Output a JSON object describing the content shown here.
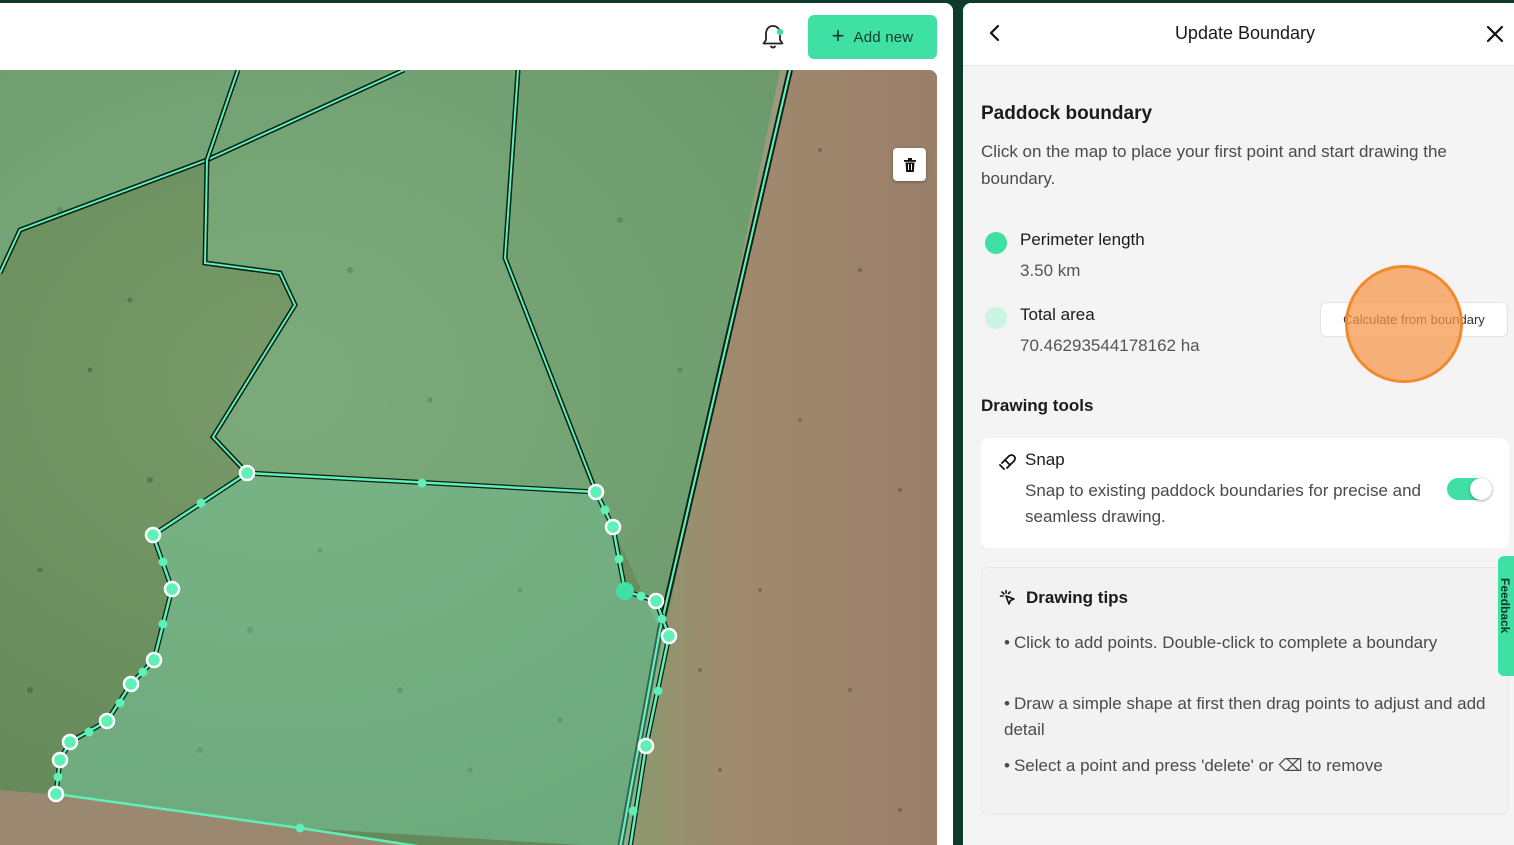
{
  "header": {
    "add_new_label": "Add new",
    "notification_icon": "bell-icon",
    "add_icon": "plus-icon"
  },
  "map": {
    "delete_icon": "trash-icon",
    "boundary_color": "#3ee0a4"
  },
  "panel": {
    "title": "Update Boundary",
    "back_icon": "chevron-left-icon",
    "close_icon": "close-icon",
    "section_title": "Paddock boundary",
    "instructions": "Click on the map to place your first point and start drawing the boundary.",
    "perimeter": {
      "label": "Perimeter length",
      "value": "3.50 km",
      "color": "#3ee0a4"
    },
    "area": {
      "label": "Total area",
      "value": "70.46293544178162 ha",
      "color": "#c9f5e2"
    },
    "calculate_button": "Calculate from boundary",
    "drawing_tools_title": "Drawing tools",
    "snap": {
      "title": "Snap",
      "icon": "magnet-icon",
      "description": "Snap to existing paddock boundaries for precise and seamless drawing.",
      "enabled": true
    },
    "tips": {
      "title": "Drawing tips",
      "icon": "sparkle-cursor-icon",
      "items": [
        "Click to add points. Double-click to complete a boundary",
        "Draw a simple shape at first then drag points to adjust and add detail",
        "Select a point and press 'delete' or ⌫ to remove"
      ]
    },
    "feedback_label": "Feedback"
  }
}
